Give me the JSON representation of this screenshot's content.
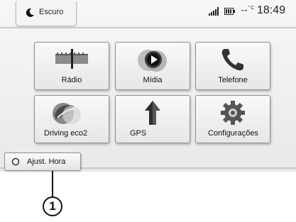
{
  "top_bar": {
    "mode_label": "Escuro",
    "temperature": "-- °C",
    "temp_value": "--",
    "temp_unit": "°C",
    "time": "18:49"
  },
  "menu": {
    "tiles": [
      {
        "label": "Rádio",
        "icon": "radio-dial-icon"
      },
      {
        "label": "Mídia",
        "icon": "media-play-icon"
      },
      {
        "label": "Telefone",
        "icon": "phone-handset-icon"
      },
      {
        "label": "Driving eco2",
        "icon": "driving-eco-leaf-icon"
      },
      {
        "label": "GPS",
        "icon": "navigation-arrow-icon"
      },
      {
        "label": "Configurações",
        "icon": "settings-gear-icon"
      }
    ]
  },
  "bottom": {
    "ajust_hora_label": "Ajust. Hora"
  },
  "callout": {
    "number": "1"
  }
}
